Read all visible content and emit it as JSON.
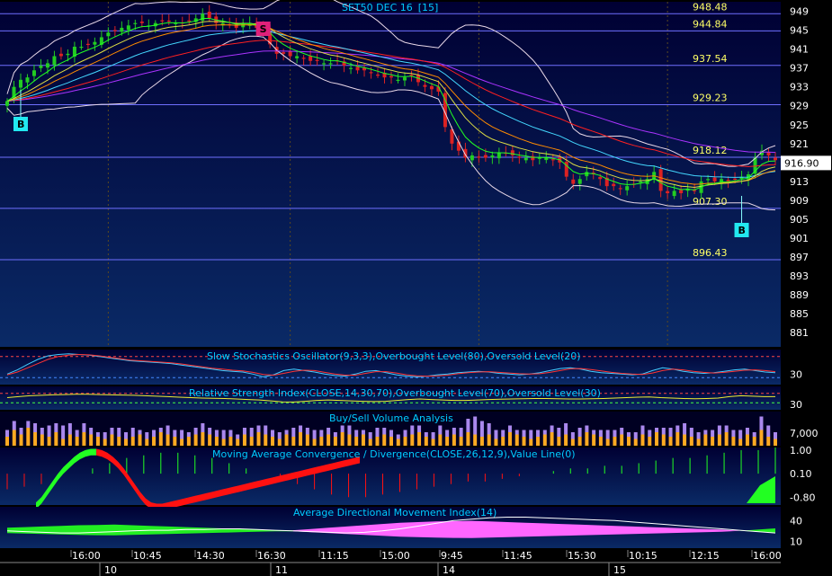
{
  "title": "SET50 DEC 16",
  "interval": "[15]",
  "colors": {
    "up": "#22cc22",
    "down": "#dd2222",
    "level_line": "#6f6fff",
    "level_text": "#ffff66",
    "title": "#00ccff",
    "bollinger": "#e8d8e8",
    "ma_purple": "#aa33ff",
    "ma_red": "#ff2020",
    "ma_cyan": "#44d8ff",
    "ma_orange": "#ff8c00",
    "ma_yellow": "#dddd44",
    "ma_green": "#22ff22",
    "macd_green": "#22ff22",
    "macd_red": "#ff1111",
    "adx_green": "#22ee22",
    "adx_pink": "#ff66ff",
    "buy_vol": "#ffaa22",
    "sell_vol": "#aa88ee"
  },
  "current_price": "916.90",
  "chart_data": [
    {
      "type": "candlestick",
      "title": "SET50 DEC 16",
      "interval": "[15]",
      "ylim": [
        878,
        951
      ],
      "y_ticks": [
        "949",
        "945",
        "941",
        "937",
        "933",
        "929",
        "925",
        "921",
        "917",
        "913",
        "909",
        "905",
        "901",
        "897",
        "893",
        "889",
        "885",
        "881"
      ],
      "x_tick_labels": [
        "16:00",
        "10:45",
        "14:30",
        "16:30",
        "11:15",
        "15:00",
        "9:45",
        "11:45",
        "15:30",
        "10:15",
        "12:15",
        "16:00"
      ],
      "date_labels": [
        "10",
        "11",
        "14",
        "15"
      ],
      "levels": [
        948.48,
        944.84,
        937.54,
        929.23,
        918.12,
        907.3,
        896.43
      ],
      "level_labels": [
        "948.48",
        "944.84",
        "937.54",
        "929.23",
        "918.12",
        "907.30",
        "896.43"
      ],
      "current_price": "916.90",
      "signals": [
        {
          "label": "B",
          "bar": 2
        },
        {
          "label": "S",
          "bar": 38
        },
        {
          "label": "B",
          "bar": 109
        }
      ],
      "close": [
        930,
        933,
        934.5,
        935,
        936.5,
        937.5,
        938,
        939.5,
        939.5,
        940,
        941.5,
        941.5,
        942,
        942.5,
        943.5,
        944.5,
        945,
        945.5,
        946,
        946.5,
        946.5,
        946,
        946.5,
        947,
        947,
        946.5,
        946.5,
        947,
        947.5,
        948.5,
        947.5,
        946.5,
        946.5,
        946,
        945.5,
        946.5,
        946.5,
        945.5,
        945,
        942,
        940,
        940,
        939.5,
        939.5,
        939,
        938.5,
        938.5,
        938,
        938,
        938.5,
        937.5,
        937,
        936.5,
        936.5,
        936,
        935.5,
        935,
        935,
        934.5,
        935,
        935.5,
        934,
        933,
        932.5,
        932,
        924.5,
        921,
        919.5,
        918,
        918.5,
        918,
        918,
        918.5,
        919,
        919,
        918.5,
        918,
        918,
        917.5,
        918,
        918,
        917.5,
        917,
        914,
        912.5,
        913.5,
        915,
        914.5,
        913.5,
        912,
        912,
        911.5,
        912,
        912.5,
        913,
        913.5,
        915,
        911,
        910.5,
        911,
        910.5,
        911.5,
        911,
        913,
        913.5,
        913,
        913.5,
        913,
        913.5,
        914,
        914.5,
        918,
        919.5,
        918.5,
        917.5
      ],
      "series": [
        {
          "name": "Bollinger Upper",
          "color": "#e8d8e8"
        },
        {
          "name": "Bollinger Lower",
          "color": "#e8d8e8"
        },
        {
          "name": "MA",
          "color": "#aa33ff"
        },
        {
          "name": "MA",
          "color": "#ff2020"
        },
        {
          "name": "MA",
          "color": "#44d8ff"
        },
        {
          "name": "MA",
          "color": "#ff8c00"
        },
        {
          "name": "MA",
          "color": "#dddd44"
        },
        {
          "name": "MA",
          "color": "#22ff22"
        }
      ]
    },
    {
      "type": "line",
      "title": "Slow Stochastics Oscillator(9,3,3),Overbought Level(80),Oversold Level(20)",
      "ylim": [
        0,
        100
      ],
      "y_ticks": [
        "30"
      ],
      "overbought": 80,
      "oversold": 20,
      "k": [
        30,
        42,
        58,
        72,
        82,
        86,
        88,
        86,
        84,
        80,
        76,
        72,
        68,
        66,
        64,
        62,
        60,
        56,
        52,
        48,
        44,
        40,
        38,
        36,
        30,
        22,
        28,
        40,
        44,
        40,
        36,
        30,
        26,
        24,
        30,
        38,
        40,
        34,
        28,
        24,
        22,
        24,
        28,
        30,
        34,
        36,
        38,
        36,
        32,
        30,
        28,
        30,
        34,
        40,
        46,
        48,
        44,
        38,
        34,
        32,
        30,
        28,
        30,
        40,
        48,
        44,
        38,
        34,
        32,
        34,
        38,
        42,
        44,
        40,
        36,
        34
      ],
      "d": [
        28,
        36,
        48,
        60,
        72,
        80,
        84,
        86,
        85,
        82,
        78,
        74,
        70,
        68,
        66,
        64,
        62,
        59,
        55,
        51,
        47,
        44,
        41,
        39,
        35,
        29,
        27,
        32,
        38,
        41,
        40,
        35,
        30,
        27,
        27,
        32,
        37,
        37,
        33,
        28,
        25,
        24,
        25,
        27,
        31,
        34,
        36,
        37,
        35,
        33,
        31,
        30,
        31,
        35,
        40,
        45,
        46,
        43,
        39,
        35,
        32,
        30,
        29,
        33,
        40,
        44,
        42,
        38,
        35,
        33,
        35,
        38,
        41,
        42,
        40,
        37
      ]
    },
    {
      "type": "line",
      "title": "Relative Strength Index(CLOSE,14,30,70),Overbought Level(70),Oversold Level(30)",
      "ylim": [
        0,
        100
      ],
      "y_ticks": [
        "30"
      ],
      "overbought": 70,
      "oversold": 30,
      "values": [
        52,
        56,
        60,
        62,
        64,
        65,
        66,
        66,
        65,
        64,
        63,
        62,
        60,
        58,
        56,
        54,
        52,
        50,
        49,
        48,
        46,
        44,
        42,
        38,
        34,
        33,
        36,
        40,
        42,
        40,
        38,
        36,
        35,
        36,
        40,
        44,
        46,
        44,
        42,
        40,
        40,
        42,
        44,
        45,
        46,
        47,
        48,
        48,
        47,
        46,
        46,
        47,
        48,
        50,
        52,
        54,
        55,
        52,
        50,
        48,
        47,
        48,
        50,
        56,
        60,
        58,
        56,
        56
      ]
    },
    {
      "type": "bar",
      "title": "Buy/Sell Volume Analysis",
      "y_ticks": [
        "7,000"
      ],
      "series": [
        {
          "name": "Buy",
          "color": "#ffaa22"
        },
        {
          "name": "Sell",
          "color": "#aa88ee"
        }
      ],
      "buy": [
        4,
        7,
        5,
        8,
        6,
        5,
        4,
        6,
        3,
        5,
        4,
        6,
        5,
        4,
        3,
        5,
        4,
        3,
        4,
        5,
        3,
        4,
        6,
        5,
        4,
        3,
        4,
        5,
        6,
        5,
        4,
        3,
        4,
        3,
        5,
        4,
        6,
        5,
        4,
        3,
        5,
        4,
        6,
        5,
        3,
        4,
        5,
        4,
        6,
        5,
        4,
        5,
        3,
        4,
        5,
        4,
        3,
        4,
        5,
        6,
        4,
        3,
        5,
        4,
        5,
        4,
        6,
        5,
        4,
        5,
        3,
        4,
        6,
        5,
        4,
        3,
        4,
        5,
        6,
        4,
        5,
        3,
        4,
        6,
        5,
        4,
        3,
        4,
        5,
        4,
        3,
        5,
        4,
        6,
        5,
        4,
        6,
        5,
        4,
        3,
        5,
        4,
        5,
        6,
        4,
        3,
        5,
        4,
        7,
        4,
        3
      ],
      "sell": [
        3,
        4,
        3,
        3,
        4,
        3,
        5,
        4,
        6,
        5,
        3,
        4,
        3,
        2,
        3,
        3,
        4,
        3,
        4,
        2,
        3,
        3,
        2,
        4,
        3,
        4,
        2,
        3,
        4,
        3,
        3,
        4,
        3,
        2,
        3,
        4,
        3,
        4,
        3,
        3,
        2,
        4,
        3,
        3,
        4,
        3,
        3,
        2,
        3,
        4,
        3,
        2,
        3,
        4,
        3,
        3,
        2,
        3,
        4,
        3,
        2,
        3,
        4,
        3,
        3,
        4,
        6,
        8,
        7,
        5,
        4,
        3,
        3,
        2,
        3,
        4,
        3,
        2,
        3,
        4,
        5,
        3,
        4,
        3,
        2,
        3,
        4,
        3,
        3,
        2,
        3,
        4,
        3,
        2,
        3,
        4,
        3,
        5,
        4,
        3,
        2,
        3,
        4,
        3,
        3,
        4,
        3,
        2,
        6,
        5,
        3
      ]
    },
    {
      "type": "area",
      "title": "Moving Average Convergence / Divergence(CLOSE,26,12,9),Value Line(0)",
      "y_ticks": [
        "1.00",
        "0.10",
        "-0.80"
      ],
      "ylim": [
        -1.1,
        1.1
      ],
      "macd": [
        -1.0,
        -0.8,
        -0.5,
        -0.2,
        0.1,
        0.35,
        0.55,
        0.75,
        0.9,
        1.0,
        1.05,
        1.05,
        1.0,
        0.9,
        0.75,
        0.55,
        0.3,
        0.0,
        -0.3,
        -0.6,
        -0.85,
        -1.0,
        -1.05,
        -1.05,
        -1.0,
        -0.95,
        -0.9,
        -0.85,
        -0.8,
        -0.75,
        -0.7,
        -0.65,
        -0.6,
        -0.55,
        -0.5,
        -0.45,
        -0.4,
        -0.35,
        -0.3,
        -0.25,
        -0.2,
        -0.15,
        -0.1,
        -0.05,
        0.0,
        0.05,
        0.1,
        0.15,
        0.2,
        0.25,
        0.3,
        0.35,
        0.4,
        0.45,
        0.5,
        0.55,
        0.6,
        0.65,
        0.7,
        0.75
      ],
      "histogram": [
        -0.6,
        -0.5,
        -0.4,
        -0.2,
        0.0,
        0.2,
        0.4,
        0.6,
        0.7,
        0.8,
        0.8,
        0.7,
        0.6,
        0.4,
        0.2,
        0.0,
        -0.2,
        -0.4,
        -0.6,
        -0.8,
        -0.9,
        -0.9,
        -0.8,
        -0.7,
        -0.6,
        -0.5,
        -0.4,
        -0.3,
        -0.3,
        -0.2,
        -0.1,
        0.0,
        0.1,
        0.2,
        0.2,
        0.3,
        0.3,
        0.4,
        0.5,
        0.6,
        0.6,
        0.7,
        0.8,
        0.9,
        0.9,
        1.0
      ]
    },
    {
      "type": "area",
      "title": "Average Directional Movement Index(14)",
      "y_ticks": [
        "40",
        "10"
      ],
      "ylim": [
        0,
        60
      ],
      "adx": [
        25,
        24,
        23,
        22,
        22,
        23,
        24,
        25,
        26,
        26,
        27,
        27,
        28,
        28,
        27,
        26,
        25,
        24,
        23,
        22,
        23,
        25,
        28,
        32,
        36,
        40,
        42,
        44,
        45,
        45,
        44,
        43,
        42,
        41,
        40,
        38,
        36,
        34,
        32,
        30,
        28,
        26,
        24,
        22
      ],
      "di_diff": [
        10,
        12,
        14,
        16,
        18,
        19,
        20,
        18,
        16,
        14,
        12,
        10,
        8,
        6,
        4,
        2,
        -2,
        -6,
        -10,
        -14,
        -18,
        -22,
        -26,
        -28,
        -30,
        -31,
        -32,
        -30,
        -28,
        -26,
        -24,
        -22,
        -20,
        -18,
        -16,
        -14,
        -12,
        -10,
        -8,
        -6,
        -4,
        0,
        4,
        8
      ]
    }
  ]
}
